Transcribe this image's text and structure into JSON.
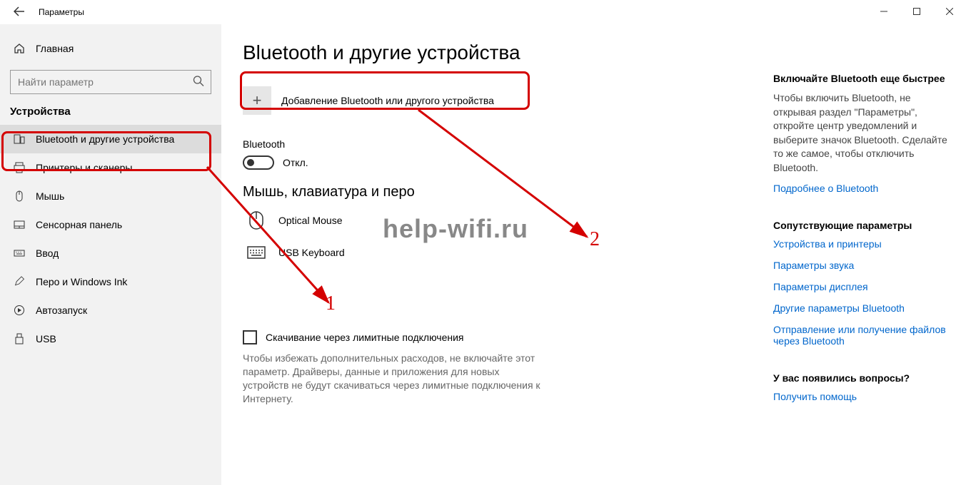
{
  "window": {
    "title": "Параметры"
  },
  "sidebar": {
    "home": "Главная",
    "search_placeholder": "Найти параметр",
    "category": "Устройства",
    "items": [
      {
        "label": "Bluetooth и другие устройства"
      },
      {
        "label": "Принтеры и сканеры"
      },
      {
        "label": "Мышь"
      },
      {
        "label": "Сенсорная панель"
      },
      {
        "label": "Ввод"
      },
      {
        "label": "Перо и Windows Ink"
      },
      {
        "label": "Автозапуск"
      },
      {
        "label": "USB"
      }
    ]
  },
  "main": {
    "title": "Bluetooth и другие устройства",
    "add_device": "Добавление Bluetooth или другого устройства",
    "bt_label": "Bluetooth",
    "bt_state": "Откл.",
    "mkp_header": "Мышь, клавиатура и перо",
    "devices": [
      {
        "name": "Optical Mouse"
      },
      {
        "name": "USB Keyboard"
      }
    ],
    "metered_label": "Скачивание через лимитные подключения",
    "metered_help": "Чтобы избежать дополнительных расходов, не включайте этот параметр. Драйверы, данные и приложения для новых устройств не будут скачиваться через лимитные подключения к Интернету."
  },
  "right": {
    "tip_header": "Включайте Bluetooth еще быстрее",
    "tip_body": "Чтобы включить Bluetooth, не открывая раздел \"Параметры\", откройте центр уведомлений и выберите значок Bluetooth. Сделайте то же самое, чтобы отключить Bluetooth.",
    "tip_link": "Подробнее о Bluetooth",
    "related_header": "Сопутствующие параметры",
    "related_links": [
      "Устройства и принтеры",
      "Параметры звука",
      "Параметры дисплея",
      "Другие параметры Bluetooth",
      "Отправление или получение файлов через Bluetooth"
    ],
    "q_header": "У вас появились вопросы?",
    "q_link": "Получить помощь"
  },
  "annotations": {
    "n1": "1",
    "n2": "2",
    "watermark": "help-wifi.ru"
  }
}
